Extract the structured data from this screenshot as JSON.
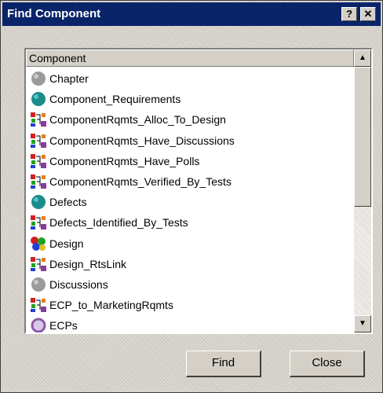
{
  "window": {
    "title": "Find Component",
    "help_glyph": "?",
    "close_glyph": "✕"
  },
  "list": {
    "column_header": "Component",
    "items": [
      {
        "label": "Chapter",
        "icon": "gray-circle-icon"
      },
      {
        "label": "Component_Requirements",
        "icon": "teal-circle-icon"
      },
      {
        "label": "ComponentRqmts_Alloc_To_Design",
        "icon": "link-icon"
      },
      {
        "label": "ComponentRqmts_Have_Discussions",
        "icon": "link-icon"
      },
      {
        "label": "ComponentRqmts_Have_Polls",
        "icon": "link-icon"
      },
      {
        "label": "ComponentRqmts_Verified_By_Tests",
        "icon": "link-icon"
      },
      {
        "label": "Defects",
        "icon": "teal-circle-icon"
      },
      {
        "label": "Defects_Identified_By_Tests",
        "icon": "link-icon"
      },
      {
        "label": "Design",
        "icon": "multicolor-balls-icon"
      },
      {
        "label": "Design_RtsLink",
        "icon": "link-icon"
      },
      {
        "label": "Discussions",
        "icon": "gray-circle-icon"
      },
      {
        "label": "ECP_to_MarketingRqmts",
        "icon": "link-icon"
      },
      {
        "label": "ECPs",
        "icon": "purple-ring-icon"
      }
    ]
  },
  "buttons": {
    "find": "Find",
    "close": "Close"
  },
  "colors": {
    "titlebar": "#0a246a",
    "teal": "#1a8c8c",
    "gray": "#9a9a9a",
    "purple": "#8a5aa8"
  }
}
